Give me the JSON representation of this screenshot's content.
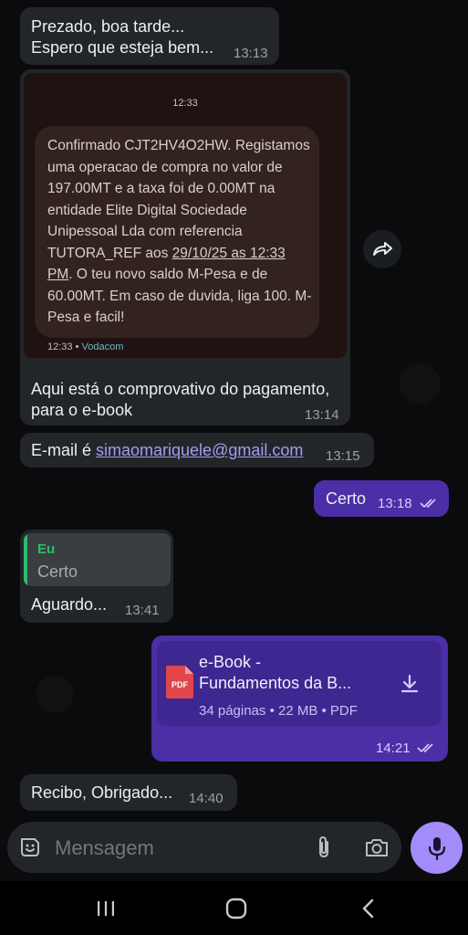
{
  "messages": {
    "greeting": {
      "line1": "Prezado, boa tarde...",
      "line2": "Espero que esteja bem...",
      "time": "13:13"
    },
    "receipt_image": {
      "header_time": "12:33",
      "sms_text_1": "Confirmado CJT2HV4O2HW. Registamos uma operacao de compra no valor de 197.00MT e a taxa foi de 0.00MT na entidade Elite Digital Sociedade Unipessoal Lda com referencia TUTORA_REF aos ",
      "sms_date": "29/10/25 as 12:33 PM",
      "sms_text_2": ". O teu novo saldo M-Pesa e de 60.00MT. Em caso de duvida, liga 100. M-Pesa e facil!",
      "footer_time": "12:33",
      "footer_sep": "•",
      "footer_carrier": "Vodacom",
      "caption_line1": "Aqui está o comprovativo do pagamento,",
      "caption_line2": "para o e-book",
      "time": "13:14"
    },
    "email": {
      "prefix": "E-mail é ",
      "address": "simaomariquele@gmail.com",
      "time": "13:15"
    },
    "certo": {
      "text": "Certo",
      "time": "13:18"
    },
    "aguardo": {
      "quote_author": "Eu",
      "quote_text": "Certo",
      "text": "Aguardo...",
      "time": "13:41"
    },
    "ebook": {
      "title_line1": "e-Book -",
      "title_line2": "Fundamentos da B...",
      "meta": "34 páginas • 22 MB • PDF",
      "pdf_badge": "PDF",
      "time": "14:21"
    },
    "recibo": {
      "text": "Recibo, Obrigado...",
      "time": "14:40"
    }
  },
  "composer": {
    "placeholder": "Mensagem"
  },
  "icons": {
    "forward": "forward-icon",
    "read_ticks": "double-check-icon",
    "download": "download-icon",
    "sticker": "sticker-icon",
    "attach": "paperclip-icon",
    "camera": "camera-icon",
    "mic": "microphone-icon"
  },
  "colors": {
    "outgoing": "#4a2fa6",
    "incoming": "#232628",
    "accent": "#a38bfa",
    "quote_bar": "#2cbc6c"
  }
}
